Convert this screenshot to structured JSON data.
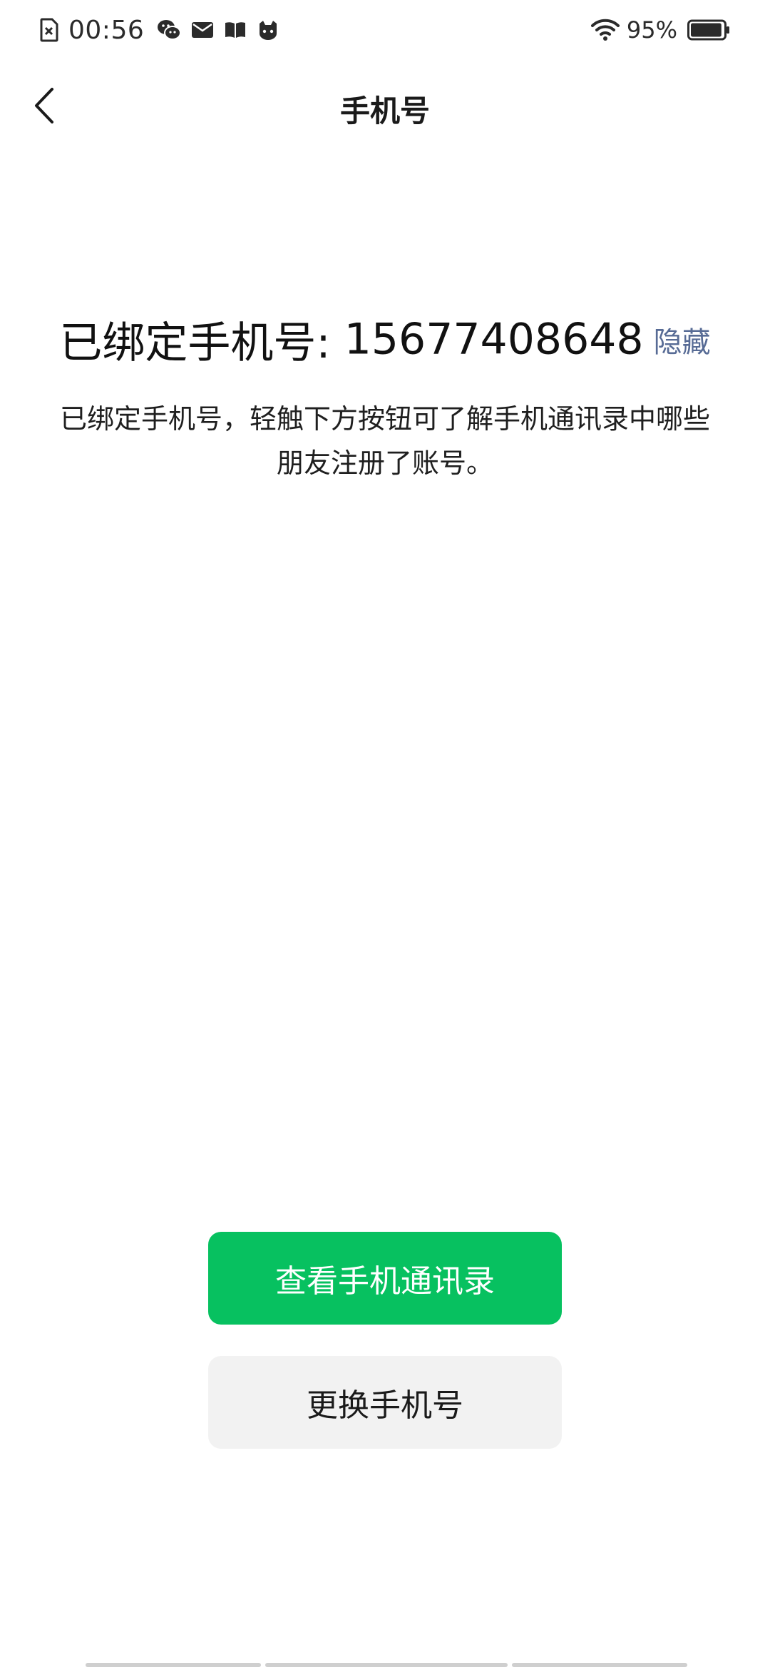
{
  "status_bar": {
    "time": "00:56",
    "battery_percent": "95%",
    "left_icons": [
      "sim-error-icon",
      "wechat-icon",
      "mail-icon",
      "book-icon",
      "cat-app-icon"
    ],
    "right_icons": [
      "wifi-icon",
      "battery-icon"
    ],
    "battery_level": 0.95
  },
  "header": {
    "title": "手机号",
    "back_icon": "chevron-left-icon"
  },
  "main": {
    "bound_label": "已绑定手机号: ",
    "phone_number": "15677408648",
    "hide_label": "隐藏",
    "description": "已绑定手机号，轻触下方按钮可了解手机通讯录中哪些朋友注册了账号。"
  },
  "actions": {
    "view_contacts_label": "查看手机通讯录",
    "change_phone_label": "更换手机号"
  },
  "colors": {
    "primary_green": "#07c160",
    "link_blue": "#576b95",
    "secondary_bg": "#f2f2f2"
  }
}
